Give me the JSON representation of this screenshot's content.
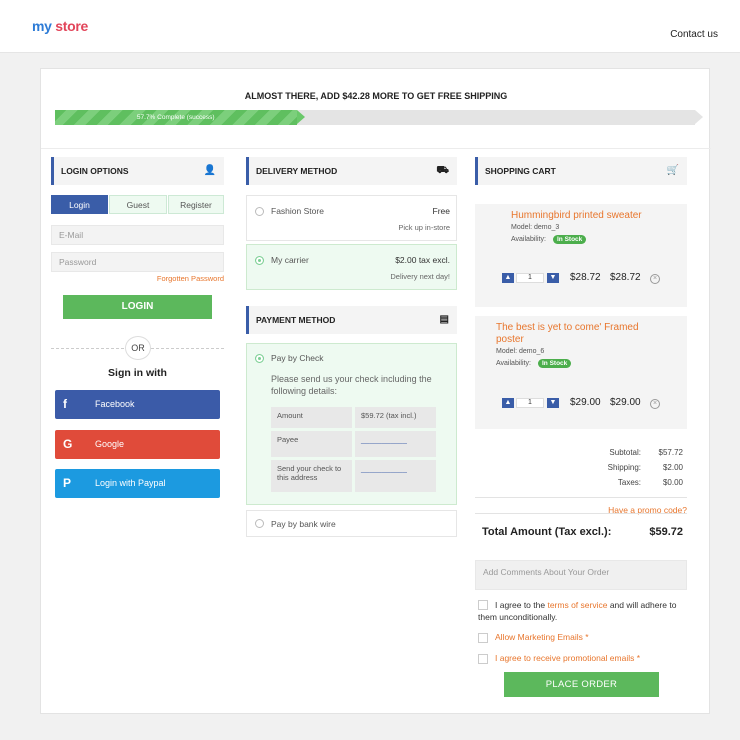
{
  "header": {
    "logo_part1": "my",
    "logo_part2": "store",
    "contact": "Contact us"
  },
  "shipping": {
    "banner": "ALMOST THERE, ADD $42.28 MORE TO GET FREE SHIPPING",
    "progress_label": "57.7% Complete (success)",
    "progress_percent": 57.7
  },
  "login": {
    "title": "LOGIN OPTIONS",
    "tabs": [
      "Login",
      "Guest",
      "Register"
    ],
    "email_placeholder": "E-Mail",
    "password_placeholder": "Password",
    "forgot": "Forgotten Password",
    "login_button": "LOGIN",
    "or": "OR",
    "sign_in_with": "Sign in with",
    "social": [
      {
        "label": "Facebook",
        "icon": "facebook-icon",
        "glyph": "f",
        "color": "#3b5ba8"
      },
      {
        "label": "Google",
        "icon": "google-icon",
        "glyph": "G",
        "color": "#e04b3a"
      },
      {
        "label": "Login with Paypal",
        "icon": "paypal-icon",
        "glyph": "P",
        "color": "#1c9ae0"
      }
    ]
  },
  "delivery": {
    "title": "DELIVERY METHOD",
    "options": [
      {
        "name": "Fashion Store",
        "price": "Free",
        "note": "Pick up in-store",
        "selected": false
      },
      {
        "name": "My carrier",
        "price": "$2.00 tax excl.",
        "note": "Delivery next day!",
        "selected": true
      }
    ]
  },
  "payment": {
    "title": "PAYMENT METHOD",
    "check_label": "Pay by Check",
    "check_desc": "Please send us your check including the following details:",
    "rows": [
      {
        "label": "Amount",
        "value": "$59.72 (tax incl.)"
      },
      {
        "label": "Payee",
        "value": "___________"
      },
      {
        "label": "Send your check to this address",
        "value": "___________"
      }
    ],
    "bankwire_label": "Pay by bank wire"
  },
  "cart": {
    "title": "SHOPPING CART",
    "items": [
      {
        "name": "Hummingbird printed sweater",
        "model": "Model: demo_3",
        "availability": "Availability:",
        "stock": "In Stock",
        "qty": "1",
        "unit_price": "$28.72",
        "total": "$28.72"
      },
      {
        "name": "The best is yet to come' Framed poster",
        "model": "Model: demo_6",
        "availability": "Availability:",
        "stock": "In Stock",
        "qty": "1",
        "unit_price": "$29.00",
        "total": "$29.00"
      }
    ],
    "subtotal_label": "Subtotal:",
    "subtotal": "$57.72",
    "shipping_label": "Shipping:",
    "shipping": "$2.00",
    "taxes_label": "Taxes:",
    "taxes": "$0.00",
    "promo": "Have a promo code?",
    "total_label": "Total Amount (Tax excl.):",
    "total": "$59.72",
    "comments_placeholder": "Add Comments About Your Order",
    "agree_prefix": "I agree to the ",
    "agree_link": "terms of service",
    "agree_suffix": " and will adhere to them unconditionally.",
    "marketing": "Allow Marketing Emails *",
    "promotional": "I agree to receive promotional emails *",
    "place_order": "PLACE ORDER"
  }
}
